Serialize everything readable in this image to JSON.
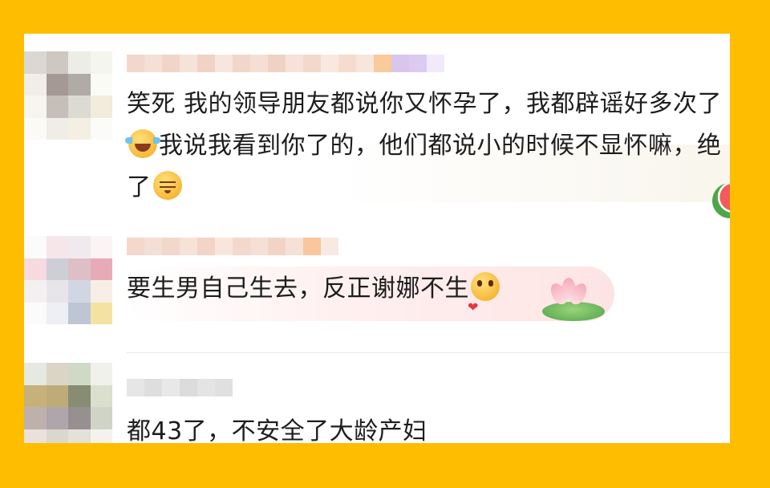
{
  "comments": [
    {
      "text_before_emoji1": "笑死 我的领导朋友都说你又怀孕了，我都辟谣好多次了",
      "emoji1": "laughing-crying-emoji-icon",
      "text_after_emoji1": "我说我看到你了的，他们都说小的时候不显怀嘛，绝了",
      "emoji2": "awkward-shy-emoji-icon"
    },
    {
      "text": "要生男自己生去，反正谢娜不生",
      "emoji": "heart-hug-emoji-icon",
      "decoration": "lotus-icon"
    },
    {
      "text": "都43了，不安全了大龄产妇"
    }
  ],
  "colors": {
    "background": "#FFBD00",
    "card": "#FFFFFF",
    "text": "#1D1D1D"
  }
}
